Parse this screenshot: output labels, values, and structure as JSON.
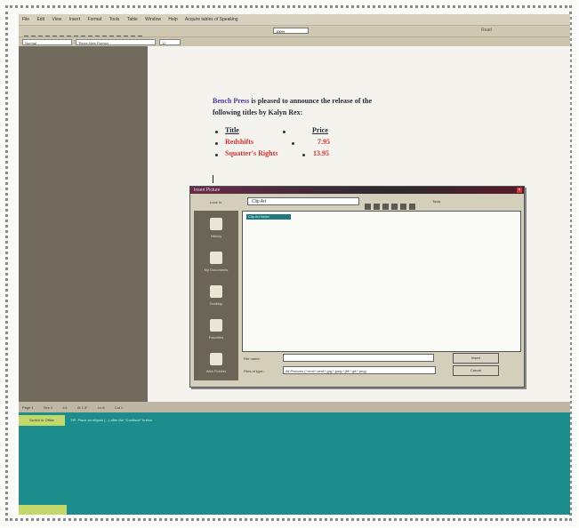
{
  "menu": {
    "items": [
      "File",
      "Edit",
      "View",
      "Insert",
      "Format",
      "Tools",
      "Table",
      "Window",
      "Help",
      "Acquire tables of Speaking"
    ]
  },
  "toolbar": {
    "zoom": "100%",
    "right_label": "Read"
  },
  "format_bar": {
    "style": "Normal",
    "font": "Times New Roman",
    "size": "12"
  },
  "document": {
    "publisher": "Bench Press",
    "announce_rest": "is pleased to announce the release of the",
    "announce_line2": "following titles by Kalyn Rex:",
    "table_header_title": "Title",
    "table_header_price": "Price",
    "rows": [
      {
        "title": "Redshifts",
        "price": "7.95"
      },
      {
        "title": "Squatter's Rights",
        "price": "13.95"
      }
    ]
  },
  "dialog": {
    "title": "Insert Picture",
    "look_in_label": "Look in:",
    "look_in_value": "Clip Art",
    "tools_label": "Tools",
    "places": [
      "History",
      "My Documents",
      "Desktop",
      "Favorites",
      "Web Folders"
    ],
    "selected_file": "Clip Art folder",
    "file_name_label": "File name:",
    "file_name_value": "",
    "files_of_type_label": "Files of type:",
    "files_of_type_value": "All Pictures (*.emf;*.wmf;*.jpg;*.jpeg;*.jfif;*.gif;*.png)",
    "insert_button": "Insert",
    "cancel_button": "Cancel"
  },
  "status_bar": {
    "page": "Page 1",
    "section": "Sec 1",
    "pages": "1/1",
    "at": "At 1.5\"",
    "line": "Ln 8",
    "col": "Col 1"
  },
  "assistant": {
    "button": "Switch to Office",
    "message": "TIP: Place an ellipsis (...) after the \"Continue\" button"
  },
  "colors": {
    "publisher": "#4b3a9a",
    "red_text": "#d43030",
    "teal": "#1c8c8c",
    "dialog_title": "#2a2a2e"
  }
}
